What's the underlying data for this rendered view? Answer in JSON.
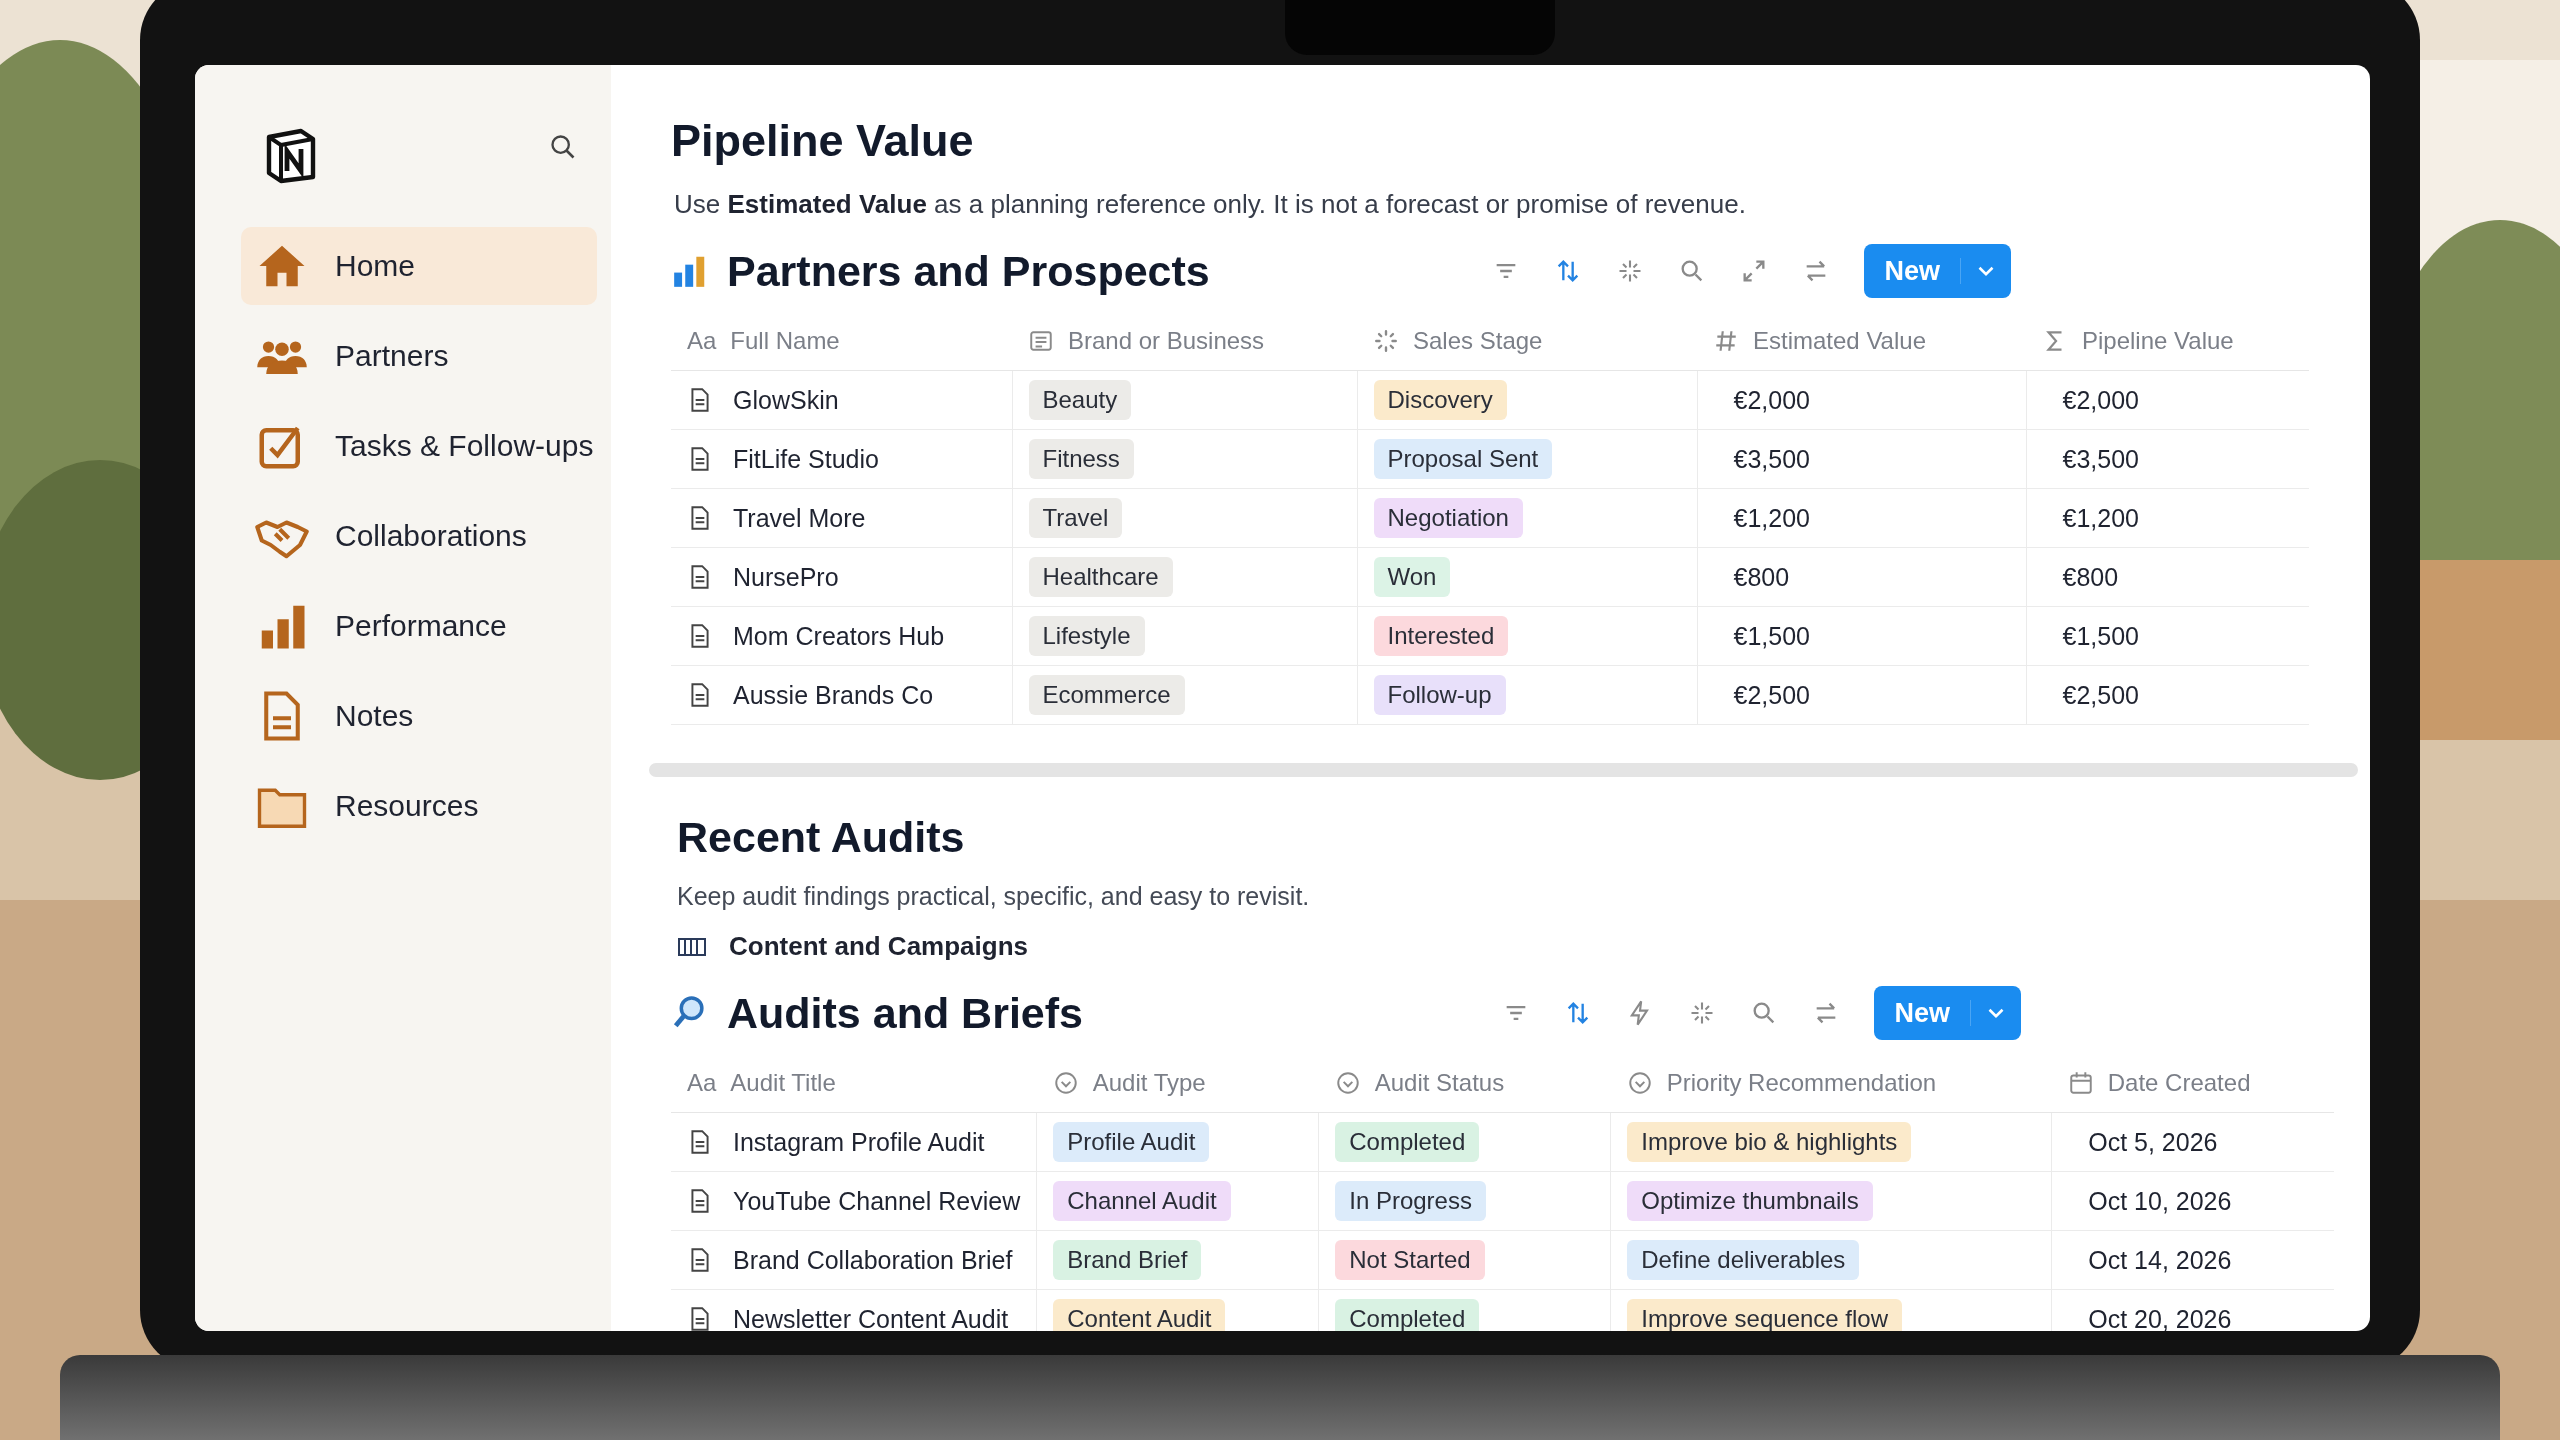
{
  "sidebar": {
    "items": [
      {
        "label": "Home",
        "selected": true
      },
      {
        "label": "Partners",
        "selected": false
      },
      {
        "label": "Tasks & Follow-ups",
        "selected": false
      },
      {
        "label": "Collaborations",
        "selected": false
      },
      {
        "label": "Performance",
        "selected": false
      },
      {
        "label": "Notes",
        "selected": false
      },
      {
        "label": "Resources",
        "selected": false
      }
    ]
  },
  "page": {
    "title": "Pipeline Value",
    "description": "Use **Estimated Value** as a planning reference only. It is not a forecast or promise of revenue."
  },
  "partners_table": {
    "title": "Partners and Prospects",
    "new_button": "New",
    "columns": [
      {
        "label": "Full Name",
        "kind": "title",
        "icon_text": "Aa"
      },
      {
        "label": "Brand or Business",
        "kind": "text"
      },
      {
        "label": "Sales Stage",
        "kind": "status"
      },
      {
        "label": "Estimated Value",
        "kind": "number"
      },
      {
        "label": "Pipeline Value",
        "kind": "formula"
      }
    ],
    "rows": [
      {
        "name": "GlowSkin",
        "brand": {
          "text": "Beauty",
          "color": "#ecebe8"
        },
        "stage": {
          "text": "Discovery",
          "color": "#fbeacb"
        },
        "estimated": "€2,000",
        "pipeline": "€2,000"
      },
      {
        "name": "FitLife Studio",
        "brand": {
          "text": "Fitness",
          "color": "#ecebe8"
        },
        "stage": {
          "text": "Proposal Sent",
          "color": "#dcebfa"
        },
        "estimated": "€3,500",
        "pipeline": "€3,500"
      },
      {
        "name": "Travel More",
        "brand": {
          "text": "Travel",
          "color": "#ecebe8"
        },
        "stage": {
          "text": "Negotiation",
          "color": "#efdcf9"
        },
        "estimated": "€1,200",
        "pipeline": "€1,200"
      },
      {
        "name": "NursePro",
        "brand": {
          "text": "Healthcare",
          "color": "#ecebe8"
        },
        "stage": {
          "text": "Won",
          "color": "#dcf3e6"
        },
        "estimated": "€800",
        "pipeline": "€800"
      },
      {
        "name": "Mom Creators Hub",
        "brand": {
          "text": "Lifestyle",
          "color": "#ecebe8"
        },
        "stage": {
          "text": "Interested",
          "color": "#fcd9dd"
        },
        "estimated": "€1,500",
        "pipeline": "€1,500"
      },
      {
        "name": "Aussie Brands Co",
        "brand": {
          "text": "Ecommerce",
          "color": "#ecebe8"
        },
        "stage": {
          "text": "Follow-up",
          "color": "#e8e0fa"
        },
        "estimated": "€2,500",
        "pipeline": "€2,500"
      }
    ]
  },
  "audits_section": {
    "title": "Recent Audits",
    "description": "Keep audit findings practical, specific, and easy to revisit.",
    "linked_page": "Content and Campaigns"
  },
  "audits_table": {
    "title": "Audits and Briefs",
    "new_button": "New",
    "columns": [
      {
        "label": "Audit Title",
        "kind": "title",
        "icon_text": "Aa"
      },
      {
        "label": "Audit Type",
        "kind": "select"
      },
      {
        "label": "Audit Status",
        "kind": "select"
      },
      {
        "label": "Priority Recommendation",
        "kind": "select"
      },
      {
        "label": "Date Created",
        "kind": "date"
      }
    ],
    "rows": [
      {
        "title": "Instagram Profile Audit",
        "type": {
          "text": "Profile Audit",
          "color": "#dcebfa"
        },
        "status": {
          "text": "Completed",
          "color": "#d9f2e3"
        },
        "priority": {
          "text": "Improve bio & highlights",
          "color": "#fbeacb"
        },
        "date": "Oct 5, 2026"
      },
      {
        "title": "YouTube Channel Review",
        "type": {
          "text": "Channel Audit",
          "color": "#efdcf9"
        },
        "status": {
          "text": "In Progress",
          "color": "#dcebfa"
        },
        "priority": {
          "text": "Optimize thumbnails",
          "color": "#efdcf9"
        },
        "date": "Oct 10, 2026"
      },
      {
        "title": "Brand Collaboration Brief",
        "type": {
          "text": "Brand Brief",
          "color": "#d9f2e3"
        },
        "status": {
          "text": "Not Started",
          "color": "#fcd9dd"
        },
        "priority": {
          "text": "Define deliverables",
          "color": "#dcebfa"
        },
        "date": "Oct 14, 2026"
      },
      {
        "title": "Newsletter Content Audit",
        "type": {
          "text": "Content Audit",
          "color": "#fbeacb"
        },
        "status": {
          "text": "Completed",
          "color": "#d9f2e3"
        },
        "priority": {
          "text": "Improve sequence flow",
          "color": "#fbeacb"
        },
        "date": "Oct 20, 2026"
      }
    ]
  }
}
